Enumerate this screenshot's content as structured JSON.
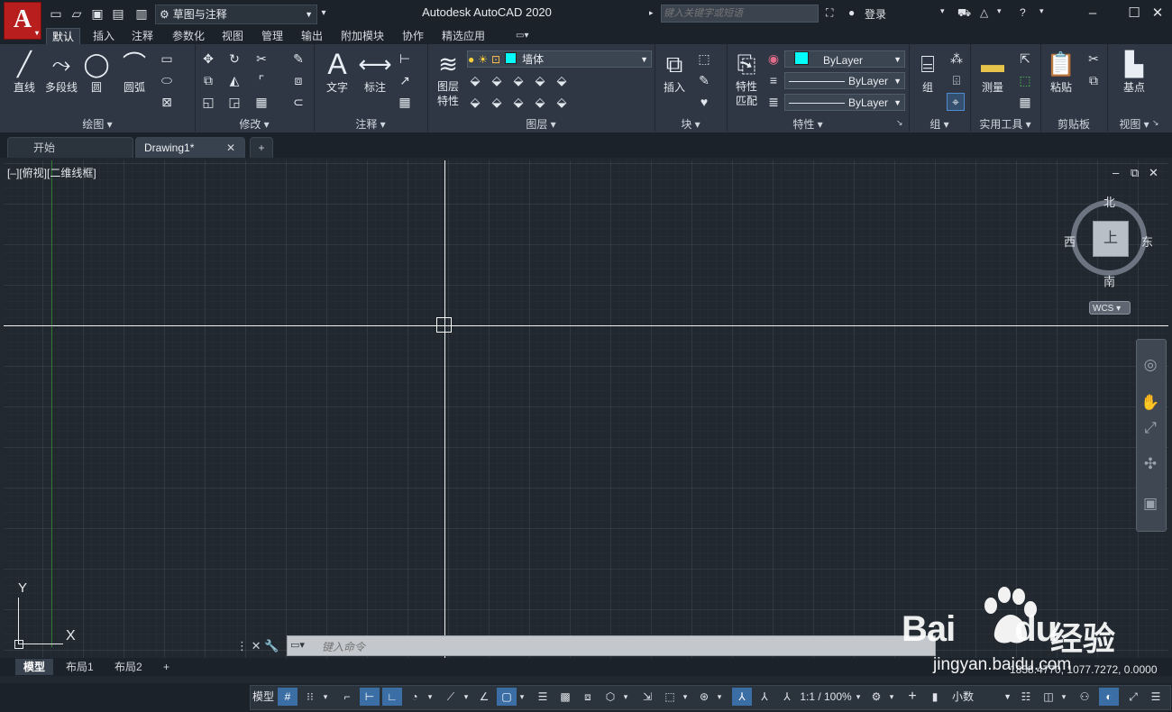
{
  "window": {
    "title": "Autodesk AutoCAD 2020",
    "workspace": "草图与注释",
    "search_placeholder": "键入关键字或短语",
    "login": "登录"
  },
  "ribbon_tabs": [
    "默认",
    "插入",
    "注释",
    "参数化",
    "视图",
    "管理",
    "输出",
    "附加模块",
    "协作",
    "精选应用"
  ],
  "panels": {
    "draw": {
      "title": "绘图",
      "line": "直线",
      "polyline": "多段线",
      "circle": "圆",
      "arc": "圆弧"
    },
    "modify": {
      "title": "修改"
    },
    "annotation": {
      "title": "注释",
      "text": "文字",
      "dimension": "标注"
    },
    "layers": {
      "title": "图层",
      "layer_props": "图层\n特性",
      "layer_props_1": "图层",
      "layer_props_2": "特性",
      "current_layer": "墙体"
    },
    "block": {
      "title": "块",
      "insert": "插入"
    },
    "properties": {
      "title": "特性",
      "match_1": "特性",
      "match_2": "匹配",
      "color": "ByLayer",
      "linetype": "ByLayer",
      "lineweight": "ByLayer"
    },
    "groups": {
      "title": "组",
      "group": "组"
    },
    "utilities": {
      "title": "实用工具",
      "measure": "测量"
    },
    "clipboard": {
      "title": "剪贴板",
      "paste": "粘贴"
    },
    "view": {
      "title": "视图",
      "base": "基点"
    }
  },
  "doc_tabs": [
    "开始",
    "Drawing1*"
  ],
  "viewport": {
    "label": "[–][俯视][二维线框]",
    "compass": {
      "north": "北",
      "south": "南",
      "east": "东",
      "west": "西",
      "top": "上"
    },
    "wcs": "WCS",
    "ucs_y": "Y",
    "ucs_x": "X"
  },
  "command": {
    "placeholder": "键入命令"
  },
  "layout_tabs": [
    "模型",
    "布局1",
    "布局2"
  ],
  "status": {
    "coords": "1858.4770, 1077.7272, 0.0000",
    "model": "模型",
    "scale": "1:1 / 100%",
    "units": "小数"
  },
  "watermark": {
    "brand": "Bai",
    "brand2": "du",
    "cn": "经验",
    "url": "jingyan.baidu.com"
  },
  "colors": {
    "accent": "#3a6ea5",
    "layer_color": "#00ffff",
    "logo": "#b81e1e"
  }
}
